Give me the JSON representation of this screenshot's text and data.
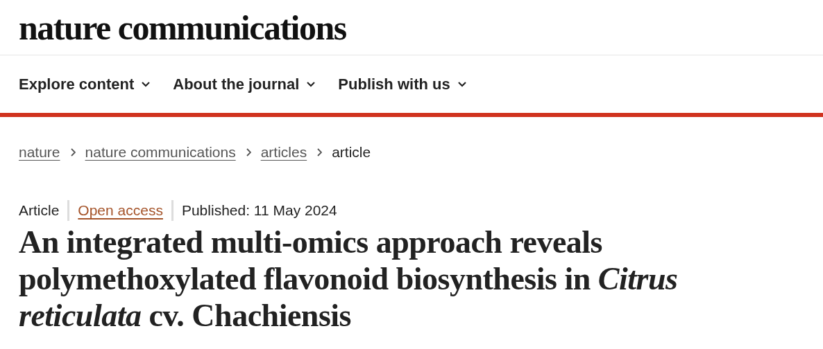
{
  "header": {
    "logo": "nature communications"
  },
  "nav": [
    {
      "label": "Explore content"
    },
    {
      "label": "About the journal"
    },
    {
      "label": "Publish with us"
    }
  ],
  "breadcrumbs": [
    {
      "label": "nature",
      "link": true
    },
    {
      "label": "nature communications",
      "link": true
    },
    {
      "label": "articles",
      "link": true
    },
    {
      "label": "article",
      "link": false
    }
  ],
  "article": {
    "type": "Article",
    "access": "Open access",
    "published": "Published: 11 May 2024",
    "title": "An integrated multi-omics approach reveals polymethoxylated flavonoid biosynthesis in *Citrus reticulata* cv. Chachiensis"
  }
}
